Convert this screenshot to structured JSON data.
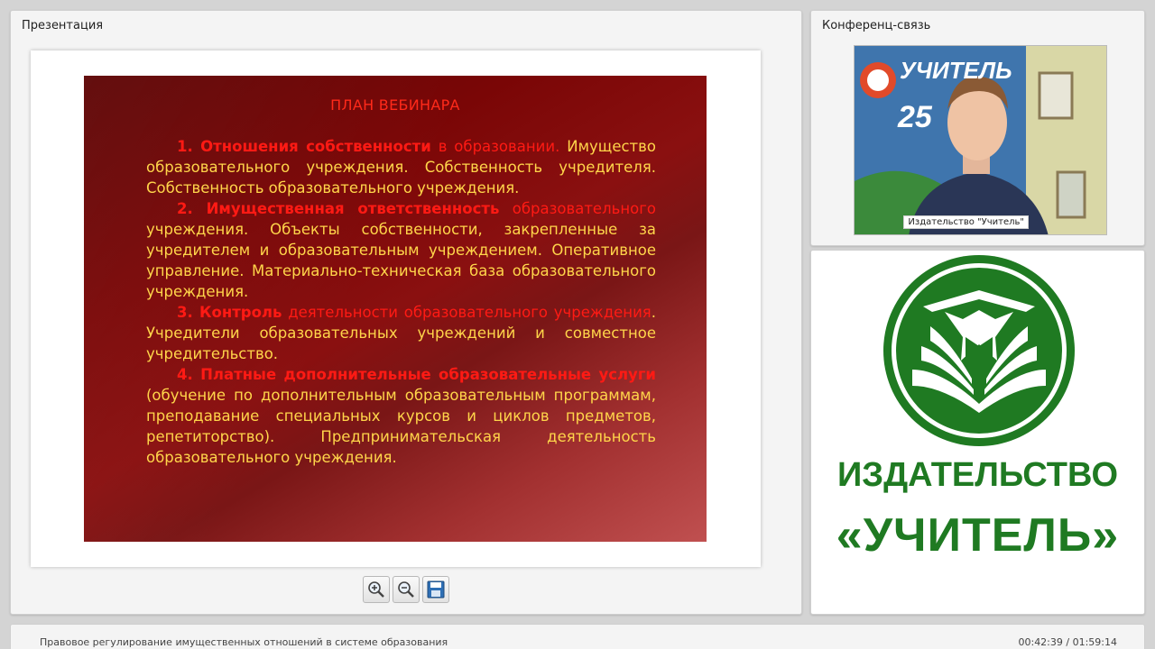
{
  "presentation": {
    "title": "Презентация",
    "slide": {
      "heading": "ПЛАН ВЕБИНАРА",
      "items": [
        {
          "lead": "1. Отношения собственности",
          "lead_tail": " в образовании.",
          "text": " Имущество образовательного учреждения. Собственность учредителя. Собственность образовательного учреждения."
        },
        {
          "lead": "2. Имущественная ответственность",
          "lead_tail": " образовательного",
          "text": " учреждения. Объекты собственности, закрепленные за учредителем и образовательным учреждением. Оперативное управление. Материально-техническая база образовательного учреждения."
        },
        {
          "lead": "3. Контроль",
          "lead_tail": " деятельности образовательного учреждения",
          "text": ". Учредители образовательных учреждений и совместное учредительство."
        },
        {
          "lead": "4. Платные дополнительные образовательные услуги",
          "lead_tail": "",
          "text": " (обучение по дополнительным образовательным программам, преподавание специальных курсов и циклов предметов, репетиторство). Предпринимательская деятельность образовательного учреждения."
        }
      ]
    },
    "toolbar": {
      "zoom_in_icon": "zoom-in-icon",
      "zoom_out_icon": "zoom-out-icon",
      "save_icon": "floppy-disk-icon"
    }
  },
  "conference": {
    "title": "Конференц-связь",
    "video_label": "Издательство \"Учитель\"",
    "backdrop_badge": "25",
    "backdrop_brand": "УЧИТЕЛЬ"
  },
  "logo": {
    "line1": "ИЗДАТЕЛЬСТВО",
    "line2": "«УЧИТЕЛЬ»"
  },
  "status": {
    "webinar_title": "Правовое регулирование имущественных отношений в системе образования",
    "time": "00:42:39 / 01:59:14"
  },
  "colors": {
    "slide_red": "#ff1a14",
    "slide_yellow": "#ffd54a",
    "logo_green": "#1f7a22"
  }
}
